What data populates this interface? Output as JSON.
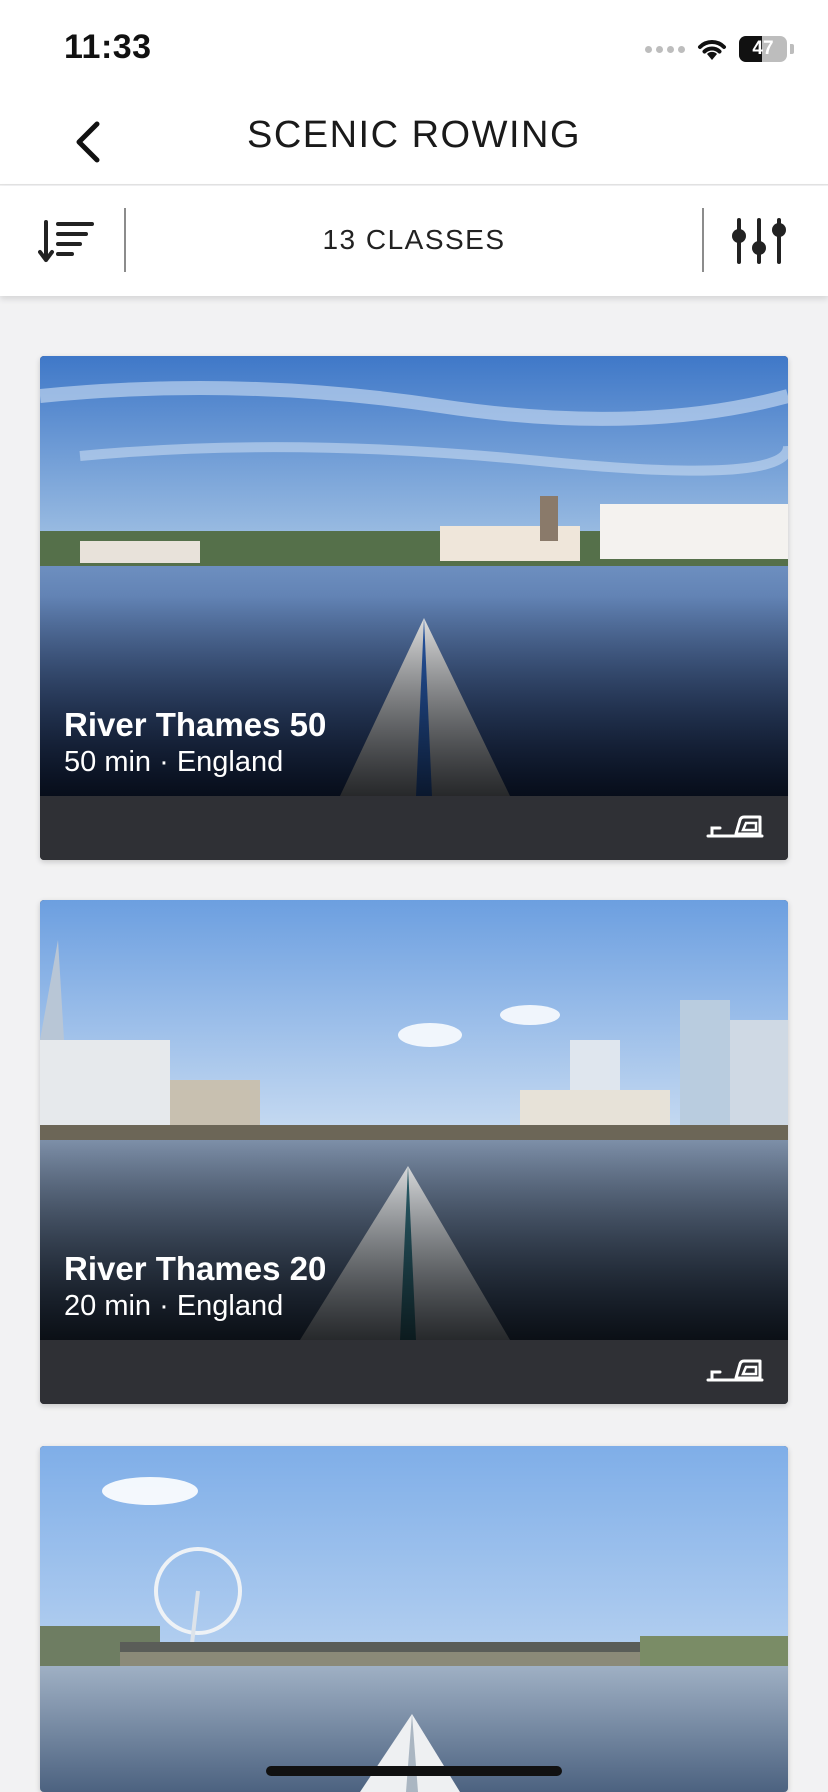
{
  "status_bar": {
    "time": "11:33",
    "battery_level": "47",
    "battery_fraction": 0.47
  },
  "nav": {
    "title": "SCENIC ROWING",
    "back_icon": "chevron-left-icon"
  },
  "toolbar": {
    "class_count": "13 CLASSES",
    "sort_icon": "sort-descending-icon",
    "filter_icon": "sliders-icon"
  },
  "classes": [
    {
      "title": "River Thames 50",
      "meta": "50 min · England",
      "equipment_icon": "rowing-machine-icon"
    },
    {
      "title": "River Thames 20",
      "meta": "20 min · England",
      "equipment_icon": "rowing-machine-icon"
    },
    {
      "title": "",
      "meta": "",
      "equipment_icon": "rowing-machine-icon"
    }
  ],
  "colors": {
    "card_footer": "#2f3035",
    "background": "#f2f2f3",
    "header": "#ffffff"
  }
}
